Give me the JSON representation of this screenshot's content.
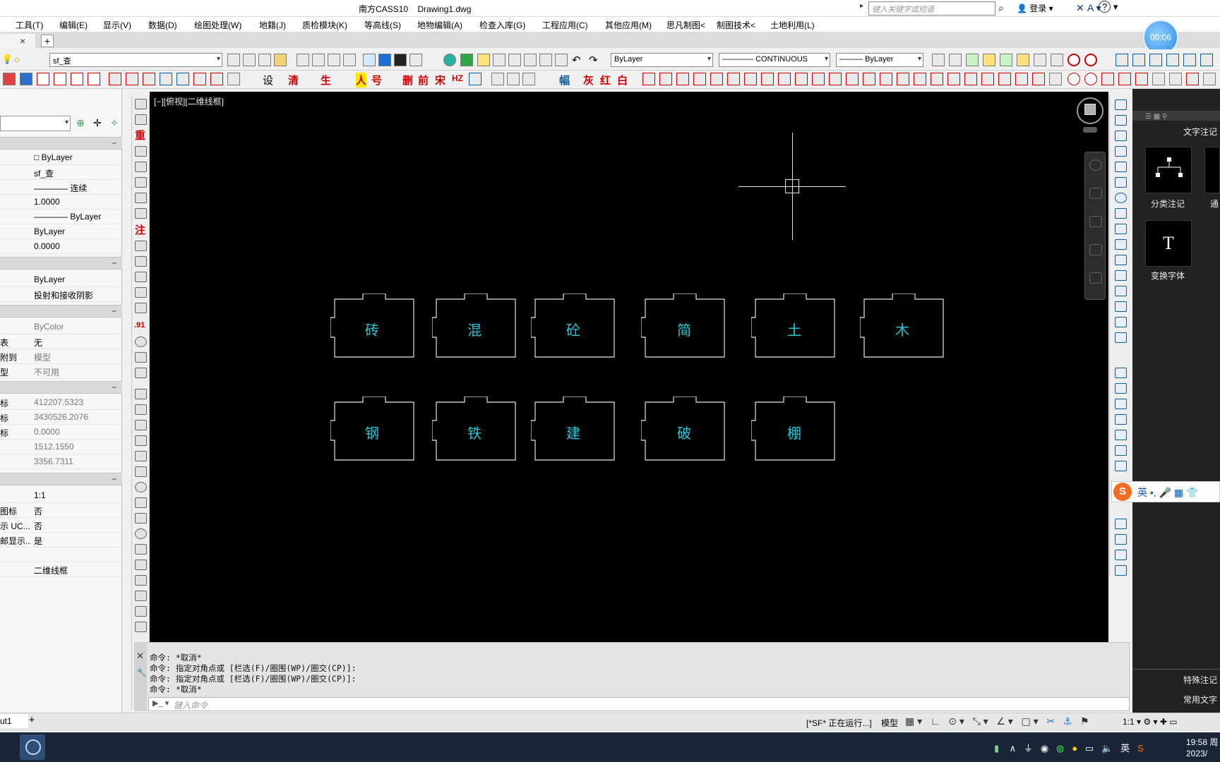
{
  "titlebar": {
    "title": "南方CASS10    Drawing1.dwg",
    "search_placeholder": "键入关键字或短语",
    "login": "登录",
    "help": "?"
  },
  "menu": [
    "工具(T)",
    "编辑(E)",
    "显示(V)",
    "数据(D)",
    "绘图处理(W)",
    "地籍(J)",
    "质检模块(K)",
    "等高线(S)",
    "地物编辑(A)",
    "检查入库(G)",
    "工程应用(C)",
    "其他应用(M)",
    "思凡制图<",
    "制图技术<",
    "土地利用(L)"
  ],
  "timer": "00:06",
  "toolbar": {
    "layer_combo": "sf_查",
    "color_combo": "ByLayer",
    "linetype_combo": "CONTINUOUS",
    "lineweight_combo": "ByLayer",
    "text_buttons": [
      "清",
      "生",
      "人",
      "号",
      "删",
      "前",
      "宋",
      "HZ",
      "幅",
      "灰",
      "红",
      "白"
    ],
    "settings_label": "设"
  },
  "properties": {
    "sections": [
      {
        "rows": [
          {
            "label": "",
            "value": "□ ByLayer"
          },
          {
            "label": "",
            "value": "sf_查"
          },
          {
            "label": "",
            "value": "———— 连续"
          },
          {
            "label": "",
            "value": "1.0000"
          },
          {
            "label": "",
            "value": "———— ByLayer"
          },
          {
            "label": "",
            "value": "ByLayer"
          },
          {
            "label": "",
            "value": "0.0000"
          }
        ]
      },
      {
        "rows": [
          {
            "label": "",
            "value": "ByLayer"
          },
          {
            "label": "",
            "value": "投射和接收阴影"
          }
        ]
      },
      {
        "rows": [
          {
            "label": "",
            "value": "ByColor",
            "gray": true
          },
          {
            "label": "表",
            "value": "无"
          },
          {
            "label": "附到",
            "value": "模型",
            "gray": true
          },
          {
            "label": "型",
            "value": "不可用",
            "gray": true
          }
        ]
      },
      {
        "rows": [
          {
            "label": "标",
            "value": "412207.5323",
            "gray": true
          },
          {
            "label": "标",
            "value": "3430526.2076",
            "gray": true
          },
          {
            "label": "标",
            "value": "0.0000",
            "gray": true
          },
          {
            "label": "",
            "value": "1512.1550",
            "gray": true
          },
          {
            "label": "",
            "value": "3356.7311",
            "gray": true
          }
        ]
      },
      {
        "rows": [
          {
            "label": "",
            "value": "1:1"
          },
          {
            "label": "图标",
            "value": "否"
          },
          {
            "label": "示 UC...",
            "value": "否"
          },
          {
            "label": "邮显示...",
            "value": "是"
          },
          {
            "label": "",
            "value": ""
          },
          {
            "label": "",
            "value": "二维线框"
          }
        ]
      }
    ]
  },
  "canvas": {
    "view_label": "[−][俯视][二维线框]",
    "drawing_color": "#e6e6e6",
    "label_color": "#22c8d8",
    "row1": [
      "砖",
      "混",
      "砼",
      "简",
      "土",
      "木"
    ],
    "row2": [
      "钢",
      "铁",
      "建",
      "破",
      "棚"
    ]
  },
  "right_panel": {
    "title": "文字注记",
    "cards": [
      {
        "label": "分类注记",
        "icon": "hierarchy-icon"
      },
      {
        "label": "通",
        "icon": "text-icon"
      },
      {
        "label": "变换字体",
        "icon": "font-T-icon",
        "glyph": "T"
      }
    ],
    "bottom": [
      "特殊注记",
      "常用文字"
    ]
  },
  "ime": {
    "mode": "英",
    "icons": "•, 🎤 ▦ 👕"
  },
  "command": {
    "lines": [
      "命令: *取消*",
      "命令: 指定对角点或 [栏选(F)/圈围(WP)/圈交(CP)]:",
      "命令: 指定对角点或 [栏选(F)/圈围(WP)/圈交(CP)]:",
      "命令: *取消*"
    ],
    "placeholder": "键入命令"
  },
  "layout": {
    "tab": "ut1"
  },
  "status": {
    "running": "[*SF* 正在运行...]",
    "model": "模型",
    "scale": "1:1"
  },
  "taskbar": {
    "time": "19:58 周",
    "date": "2023/",
    "tray_lang": "英"
  }
}
